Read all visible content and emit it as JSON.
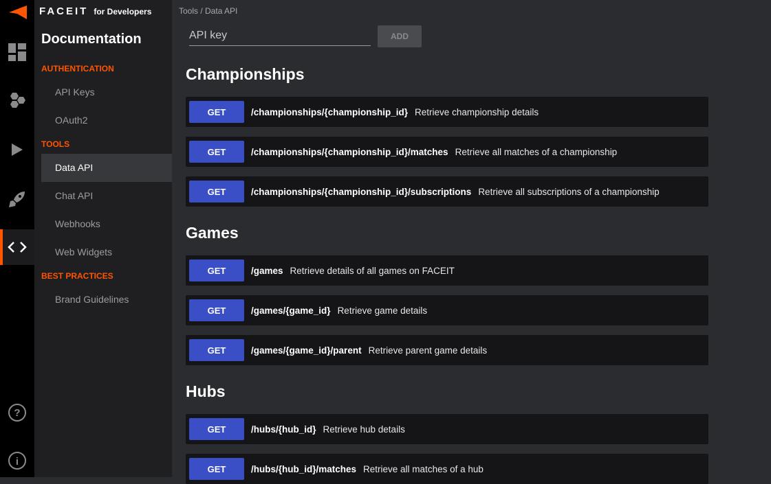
{
  "brand": {
    "wordmark": "FACEIT",
    "suffix": "for Developers",
    "accent": "#ff5500"
  },
  "rail": {
    "items": [
      {
        "icon": "dashboard-icon"
      },
      {
        "icon": "hexagons-icon"
      },
      {
        "icon": "play-icon"
      },
      {
        "icon": "rocket-icon"
      },
      {
        "icon": "code-icon",
        "active": true
      }
    ],
    "bottom": [
      {
        "icon": "help-icon"
      },
      {
        "icon": "info-icon"
      }
    ]
  },
  "sidebar": {
    "title": "Documentation",
    "sections": [
      {
        "label": "AUTHENTICATION",
        "items": [
          "API Keys",
          "OAuth2"
        ]
      },
      {
        "label": "TOOLS",
        "items": [
          "Data API",
          "Chat API",
          "Webhooks",
          "Web Widgets"
        ],
        "active": "Data API"
      },
      {
        "label": "BEST PRACTICES",
        "items": [
          "Brand Guidelines"
        ]
      }
    ]
  },
  "main": {
    "breadcrumb": "Tools / Data API",
    "api_key_placeholder": "API key",
    "add_label": "ADD",
    "method_color": "#3a4ec5",
    "groups": [
      {
        "title": "Championships",
        "endpoints": [
          {
            "method": "GET",
            "path": "/championships/{championship_id}",
            "desc": "Retrieve championship details"
          },
          {
            "method": "GET",
            "path": "/championships/{championship_id}/matches",
            "desc": "Retrieve all matches of a championship"
          },
          {
            "method": "GET",
            "path": "/championships/{championship_id}/subscriptions",
            "desc": "Retrieve all subscriptions of a championship"
          }
        ]
      },
      {
        "title": "Games",
        "endpoints": [
          {
            "method": "GET",
            "path": "/games",
            "desc": "Retrieve details of all games on FACEIT"
          },
          {
            "method": "GET",
            "path": "/games/{game_id}",
            "desc": "Retrieve game details"
          },
          {
            "method": "GET",
            "path": "/games/{game_id}/parent",
            "desc": "Retrieve parent game details"
          }
        ]
      },
      {
        "title": "Hubs",
        "endpoints": [
          {
            "method": "GET",
            "path": "/hubs/{hub_id}",
            "desc": "Retrieve hub details"
          },
          {
            "method": "GET",
            "path": "/hubs/{hub_id}/matches",
            "desc": "Retrieve all matches of a hub"
          }
        ]
      }
    ]
  }
}
